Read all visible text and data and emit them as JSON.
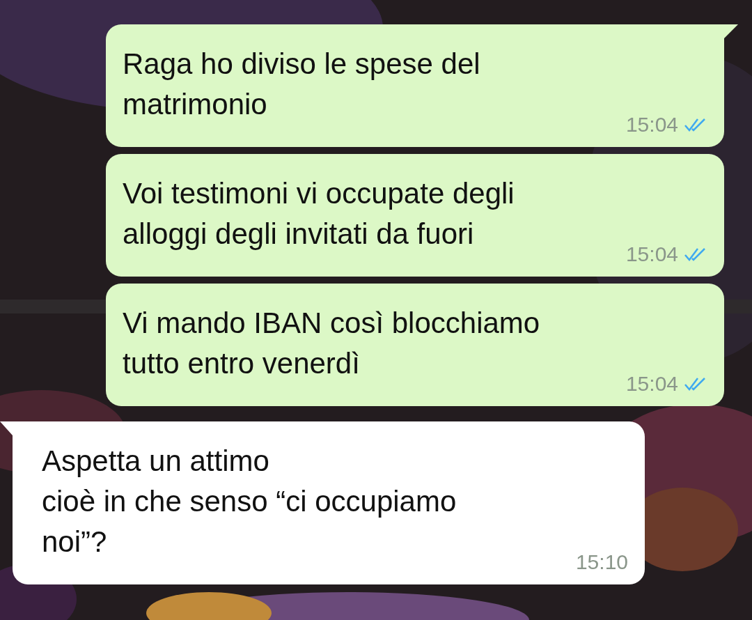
{
  "messages": [
    {
      "kind": "outgoing",
      "tail": true,
      "lines": [
        "Raga ho diviso le spese del",
        "matrimonio"
      ],
      "time": "15:04",
      "read": true
    },
    {
      "kind": "outgoing",
      "tail": false,
      "lines": [
        "Voi testimoni vi occupate degli",
        "alloggi degli invitati da fuori"
      ],
      "time": "15:04",
      "read": true
    },
    {
      "kind": "outgoing",
      "tail": false,
      "lines": [
        "Vi mando IBAN così blocchiamo",
        "tutto entro venerdì"
      ],
      "time": "15:04",
      "read": true
    },
    {
      "kind": "incoming",
      "tail": true,
      "lines": [
        "Aspetta un attimo",
        "cioè in che senso “ci occupiamo",
        "noi”?"
      ],
      "time": "15:10"
    }
  ]
}
